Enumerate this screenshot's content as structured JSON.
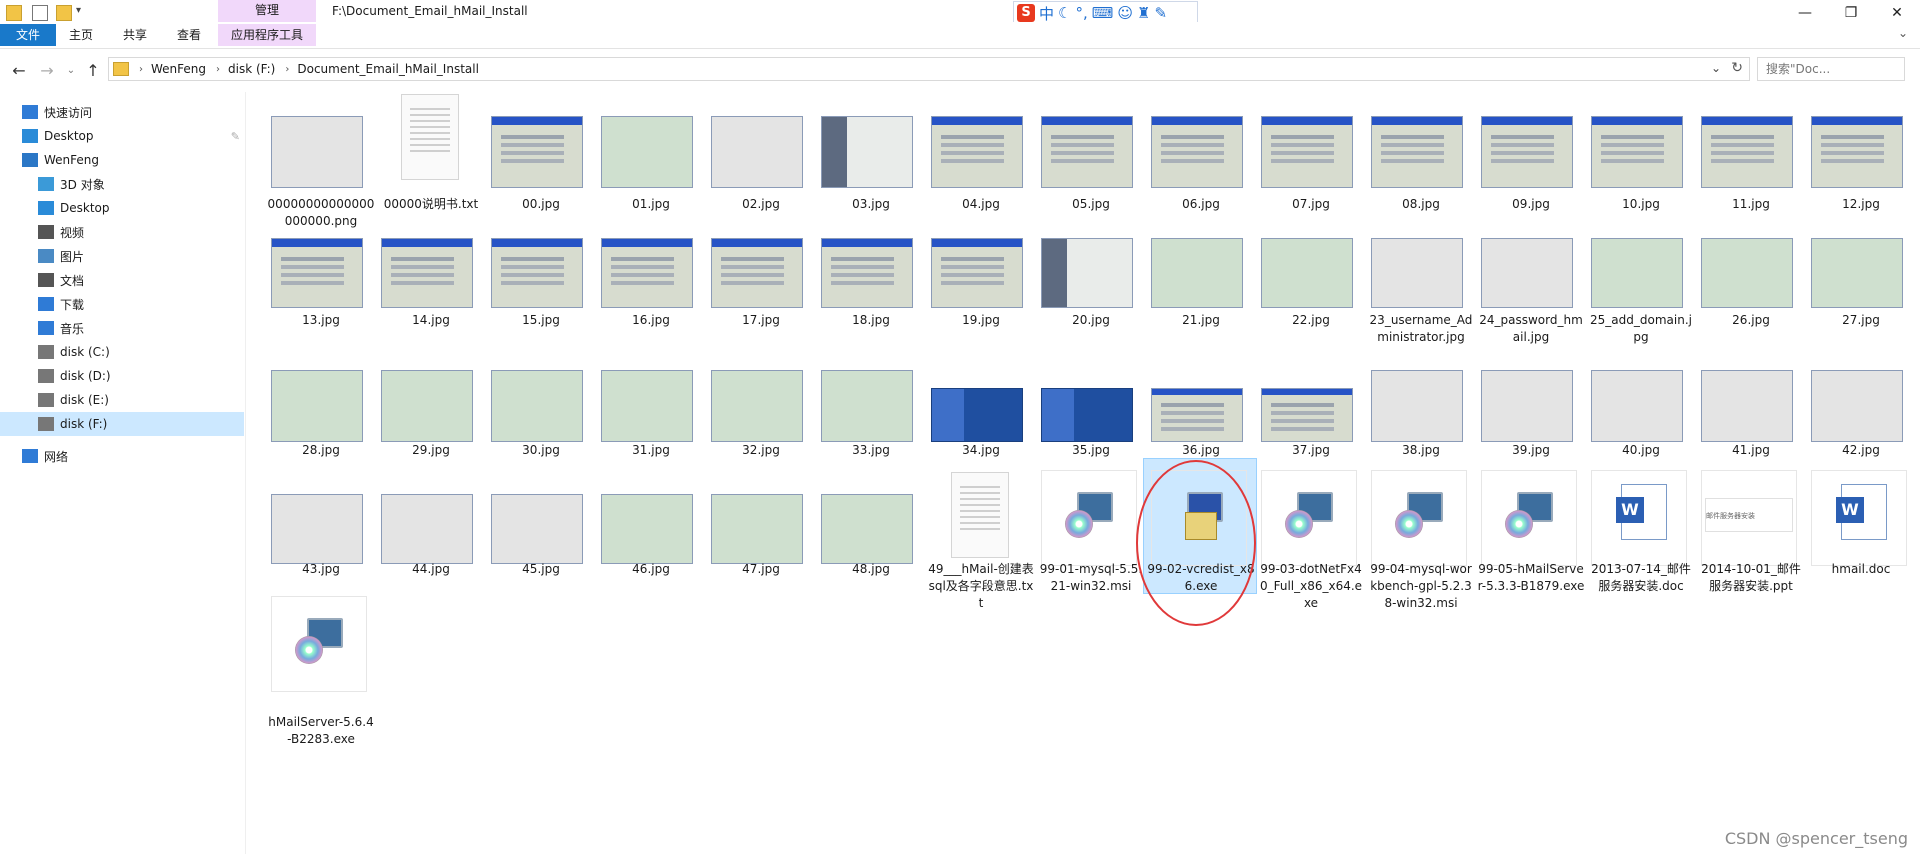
{
  "window": {
    "title": "F:\\Document_Email_hMail_Install",
    "manage_tab": "管理"
  },
  "ribbon": {
    "tabs": [
      "文件",
      "主页",
      "共享",
      "查看",
      "应用程序工具"
    ]
  },
  "ime": {
    "label": "中"
  },
  "address": {
    "crumbs": [
      "WenFeng",
      "disk (F:)",
      "Document_Email_hMail_Install"
    ],
    "search_placeholder": "搜索\"Doc..."
  },
  "nav": {
    "items": [
      {
        "label": "快速访问",
        "icon": "star-icon"
      },
      {
        "label": "Desktop",
        "icon": "desktop-icon"
      },
      {
        "label": "WenFeng",
        "icon": "computer-icon"
      },
      {
        "label": "3D 对象",
        "icon": "cube-icon"
      },
      {
        "label": "Desktop",
        "icon": "desktop-icon"
      },
      {
        "label": "视频",
        "icon": "video-icon"
      },
      {
        "label": "图片",
        "icon": "picture-icon"
      },
      {
        "label": "文档",
        "icon": "document-icon"
      },
      {
        "label": "下载",
        "icon": "download-icon"
      },
      {
        "label": "音乐",
        "icon": "music-icon"
      },
      {
        "label": "disk (C:)",
        "icon": "drive-icon"
      },
      {
        "label": "disk (D:)",
        "icon": "drive-icon"
      },
      {
        "label": "disk (E:)",
        "icon": "drive-icon"
      },
      {
        "label": "disk (F:)",
        "icon": "drive-icon"
      },
      {
        "label": "网络",
        "icon": "network-icon"
      }
    ],
    "selected": "disk (F:)"
  },
  "files": [
    {
      "name": "00000000000000000000.png",
      "kind": "gray"
    },
    {
      "name": "00000说明书.txt",
      "kind": "txt"
    },
    {
      "name": "00.jpg",
      "kind": "xp"
    },
    {
      "name": "01.jpg",
      "kind": "green"
    },
    {
      "name": "02.jpg",
      "kind": "gray"
    },
    {
      "name": "03.jpg",
      "kind": "wiz"
    },
    {
      "name": "04.jpg",
      "kind": "xp"
    },
    {
      "name": "05.jpg",
      "kind": "xp"
    },
    {
      "name": "06.jpg",
      "kind": "xp"
    },
    {
      "name": "07.jpg",
      "kind": "xp"
    },
    {
      "name": "08.jpg",
      "kind": "xp"
    },
    {
      "name": "09.jpg",
      "kind": "xp"
    },
    {
      "name": "10.jpg",
      "kind": "xp"
    },
    {
      "name": "11.jpg",
      "kind": "xp"
    },
    {
      "name": "12.jpg",
      "kind": "xp"
    },
    {
      "name": "13.jpg",
      "kind": "xp"
    },
    {
      "name": "14.jpg",
      "kind": "xp"
    },
    {
      "name": "15.jpg",
      "kind": "xp"
    },
    {
      "name": "16.jpg",
      "kind": "xp"
    },
    {
      "name": "17.jpg",
      "kind": "xp"
    },
    {
      "name": "18.jpg",
      "kind": "xp"
    },
    {
      "name": "19.jpg",
      "kind": "xp"
    },
    {
      "name": "20.jpg",
      "kind": "wiz"
    },
    {
      "name": "21.jpg",
      "kind": "green"
    },
    {
      "name": "22.jpg",
      "kind": "green"
    },
    {
      "name": "23_username_Administrator.jpg",
      "kind": "gray"
    },
    {
      "name": "24_password_hmail.jpg",
      "kind": "gray"
    },
    {
      "name": "25_add_domain.jpg",
      "kind": "green"
    },
    {
      "name": "26.jpg",
      "kind": "green"
    },
    {
      "name": "27.jpg",
      "kind": "green"
    },
    {
      "name": "28.jpg",
      "kind": "green"
    },
    {
      "name": "29.jpg",
      "kind": "green"
    },
    {
      "name": "30.jpg",
      "kind": "green"
    },
    {
      "name": "31.jpg",
      "kind": "green"
    },
    {
      "name": "32.jpg",
      "kind": "green"
    },
    {
      "name": "33.jpg",
      "kind": "green"
    },
    {
      "name": "34.jpg",
      "kind": "blue"
    },
    {
      "name": "35.jpg",
      "kind": "blue"
    },
    {
      "name": "36.jpg",
      "kind": "xp"
    },
    {
      "name": "37.jpg",
      "kind": "xp"
    },
    {
      "name": "38.jpg",
      "kind": "gray"
    },
    {
      "name": "39.jpg",
      "kind": "gray"
    },
    {
      "name": "40.jpg",
      "kind": "gray"
    },
    {
      "name": "41.jpg",
      "kind": "gray"
    },
    {
      "name": "42.jpg",
      "kind": "gray"
    },
    {
      "name": "43.jpg",
      "kind": "gray"
    },
    {
      "name": "44.jpg",
      "kind": "gray"
    },
    {
      "name": "45.jpg",
      "kind": "gray"
    },
    {
      "name": "46.jpg",
      "kind": "green"
    },
    {
      "name": "47.jpg",
      "kind": "green"
    },
    {
      "name": "48.jpg",
      "kind": "green"
    },
    {
      "name": "49___hMail-创建表sql及各字段意思.txt",
      "kind": "txt"
    },
    {
      "name": "99-01-mysql-5.5.21-win32.msi",
      "kind": "exe"
    },
    {
      "name": "99-02-vcredist_x86.exe",
      "kind": "exe2"
    },
    {
      "name": "99-03-dotNetFx40_Full_x86_x64.exe",
      "kind": "exe"
    },
    {
      "name": "99-04-mysql-workbench-gpl-5.2.38-win32.msi",
      "kind": "exe"
    },
    {
      "name": "99-05-hMailServer-5.3.3-B1879.exe",
      "kind": "exe"
    },
    {
      "name": "2013-07-14_邮件服务器安装.doc",
      "kind": "doc"
    },
    {
      "name": "2014-10-01_邮件服务器安装.ppt",
      "kind": "ppt"
    },
    {
      "name": "hmail.doc",
      "kind": "doc"
    },
    {
      "name": "hMailServer-5.6.4-B2283.exe",
      "kind": "exe"
    }
  ],
  "selected_file": "99-02-vcredist_x86.exe",
  "ppt_thumb_text": "邮件服务器安装",
  "watermark": "CSDN @spencer_tseng"
}
